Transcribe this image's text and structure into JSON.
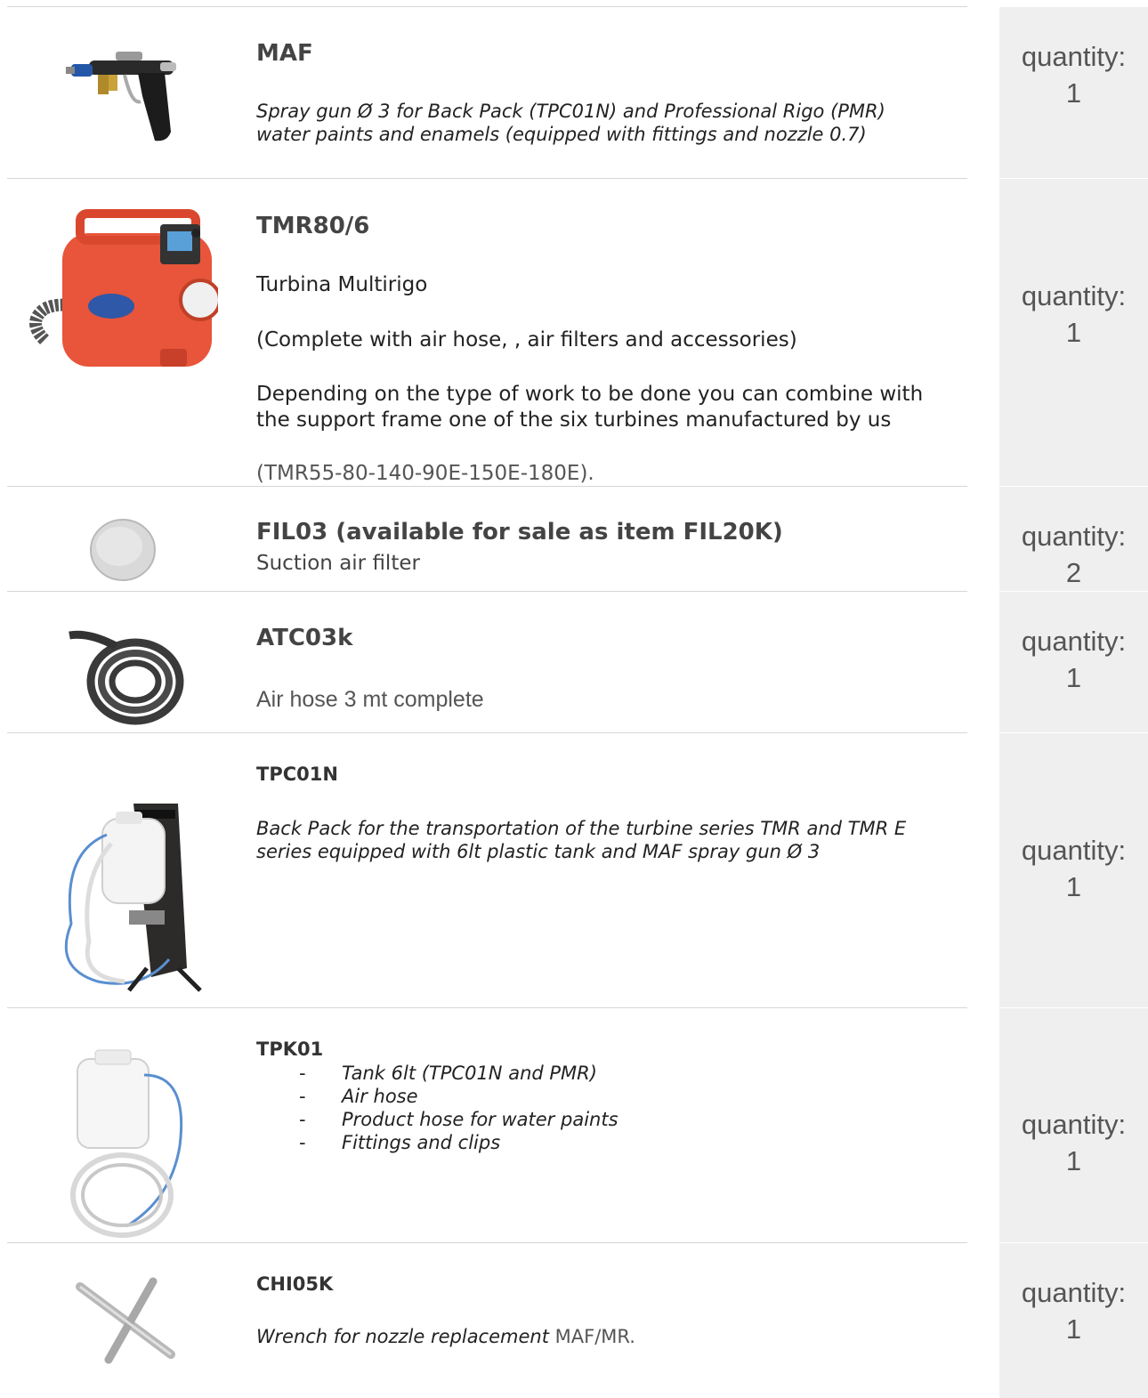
{
  "quantity_label": "quantity:",
  "items": [
    {
      "code": "MAF",
      "description": "Spray gun Ø 3 for Back Pack (TPC01N) and Professional Rigo (PMR) water paints and enamels (equipped with fittings and nozzle 0.7)",
      "quantity": "1",
      "icon": "spray-gun-icon"
    },
    {
      "code": "TMR80/6",
      "line1": "Turbina  Multirigo",
      "line2": "(Complete with air hose, , air filters and accessories)",
      "line3": "Depending on the type of work to be done you can combine with the support frame one of the six turbines manufactured by us",
      "line4": "(TMR55-80-140-90E-150E-180E).",
      "quantity": "1",
      "icon": "turbine-icon"
    },
    {
      "code": "FIL03 (available for sale as item FIL20K)",
      "description": "Suction air filter",
      "quantity": "2",
      "icon": "air-filter-icon"
    },
    {
      "code": "ATC03k",
      "description": "Air hose 3 mt complete",
      "quantity": "1",
      "icon": "air-hose-icon"
    },
    {
      "code": "TPC01N",
      "description": "Back Pack for the transportation of the turbine series TMR and TMR E series equipped with 6lt plastic tank and MAF spray gun Ø 3",
      "quantity": "1",
      "icon": "back-pack-icon"
    },
    {
      "code": "TPK01",
      "list": [
        "Tank 6lt (TPC01N and PMR)",
        "Air hose",
        "Product hose for water paints",
        "Fittings and clips"
      ],
      "quantity": "1",
      "icon": "tank-icon"
    },
    {
      "code": "CHI05K",
      "description_italic": "Wrench for nozzle replacement",
      "description_plain": " MAF/MR.",
      "quantity": "1",
      "icon": "wrench-icon"
    }
  ]
}
